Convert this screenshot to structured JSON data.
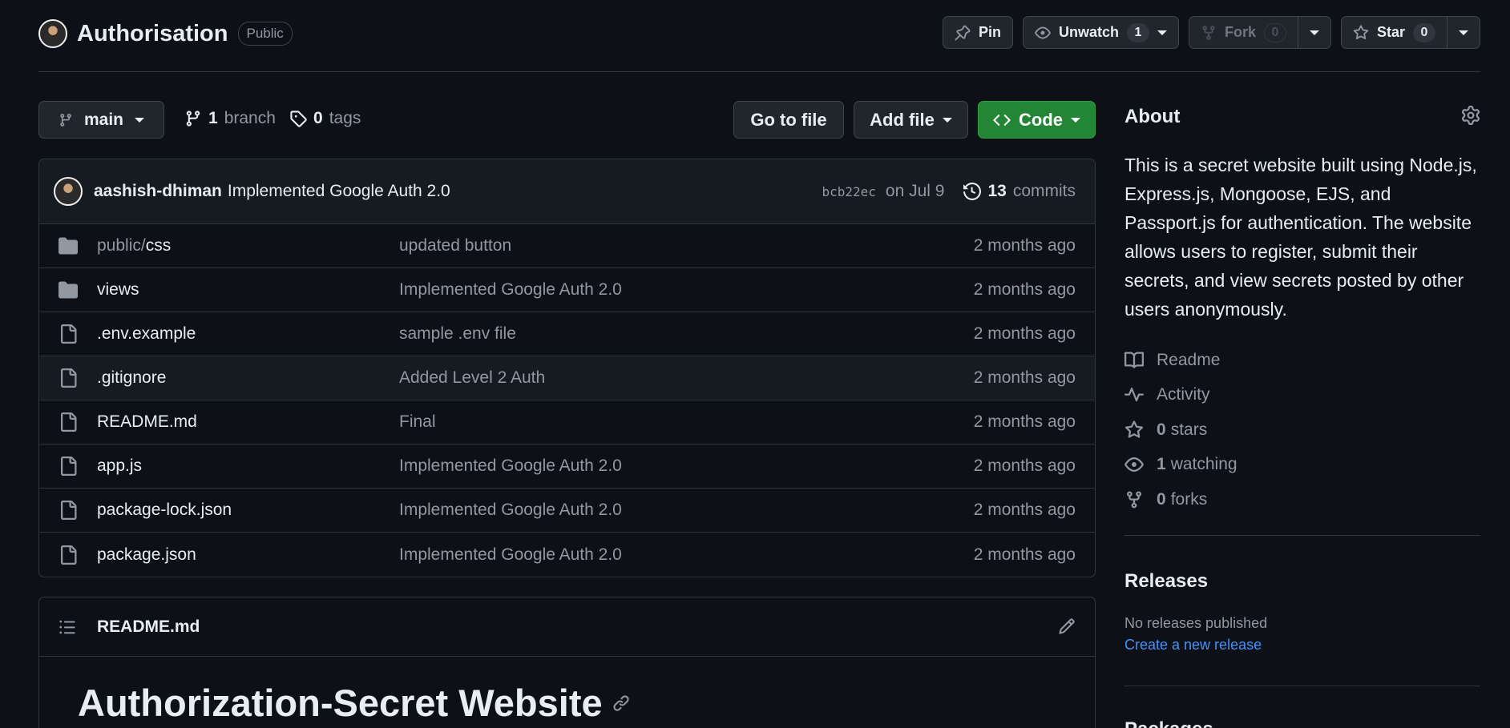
{
  "repo": {
    "name": "Authorisation",
    "visibility": "Public"
  },
  "header_actions": {
    "pin_label": "Pin",
    "unwatch_label": "Unwatch",
    "unwatch_count": "1",
    "fork_label": "Fork",
    "fork_count": "0",
    "star_label": "Star",
    "star_count": "0"
  },
  "toolbar": {
    "branch": "main",
    "branch_count": "1",
    "branch_word": "branch",
    "tag_count": "0",
    "tag_word": "tags",
    "go_to_file": "Go to file",
    "add_file": "Add file",
    "code": "Code"
  },
  "latest_commit": {
    "author": "aashish-dhiman",
    "message": "Implemented Google Auth 2.0",
    "sha": "bcb22ec",
    "date": "on Jul 9",
    "commit_count": "13",
    "commit_word": "commits"
  },
  "files": [
    {
      "type": "folder",
      "name_dim": "public/",
      "name": "css",
      "message": "updated button",
      "age": "2 months ago"
    },
    {
      "type": "folder",
      "name_dim": "",
      "name": "views",
      "message": "Implemented Google Auth 2.0",
      "age": "2 months ago"
    },
    {
      "type": "file",
      "name_dim": "",
      "name": ".env.example",
      "message": "sample .env file",
      "age": "2 months ago"
    },
    {
      "type": "file",
      "name_dim": "",
      "name": ".gitignore",
      "message": "Added Level 2 Auth",
      "age": "2 months ago"
    },
    {
      "type": "file",
      "name_dim": "",
      "name": "README.md",
      "message": "Final",
      "age": "2 months ago"
    },
    {
      "type": "file",
      "name_dim": "",
      "name": "app.js",
      "message": "Implemented Google Auth 2.0",
      "age": "2 months ago"
    },
    {
      "type": "file",
      "name_dim": "",
      "name": "package-lock.json",
      "message": "Implemented Google Auth 2.0",
      "age": "2 months ago"
    },
    {
      "type": "file",
      "name_dim": "",
      "name": "package.json",
      "message": "Implemented Google Auth 2.0",
      "age": "2 months ago"
    }
  ],
  "readme": {
    "filename": "README.md",
    "heading": "Authorization-Secret Website"
  },
  "about": {
    "title": "About",
    "description": "This is a secret website built using Node.js, Express.js, Mongoose, EJS, and Passport.js for authentication. The website allows users to register, submit their secrets, and view secrets posted by other users anonymously.",
    "links": {
      "readme": "Readme",
      "activity": "Activity",
      "stars_count": "0",
      "stars_word": "stars",
      "watching_count": "1",
      "watching_word": "watching",
      "forks_count": "0",
      "forks_word": "forks"
    }
  },
  "releases": {
    "title": "Releases",
    "none_text": "No releases published",
    "create_link": "Create a new release"
  },
  "packages": {
    "title": "Packages"
  },
  "colors": {
    "background": "#0d1117",
    "border": "#30363d",
    "code_button": "#238636",
    "link": "#4493f8",
    "muted_text": "#9198a1"
  }
}
